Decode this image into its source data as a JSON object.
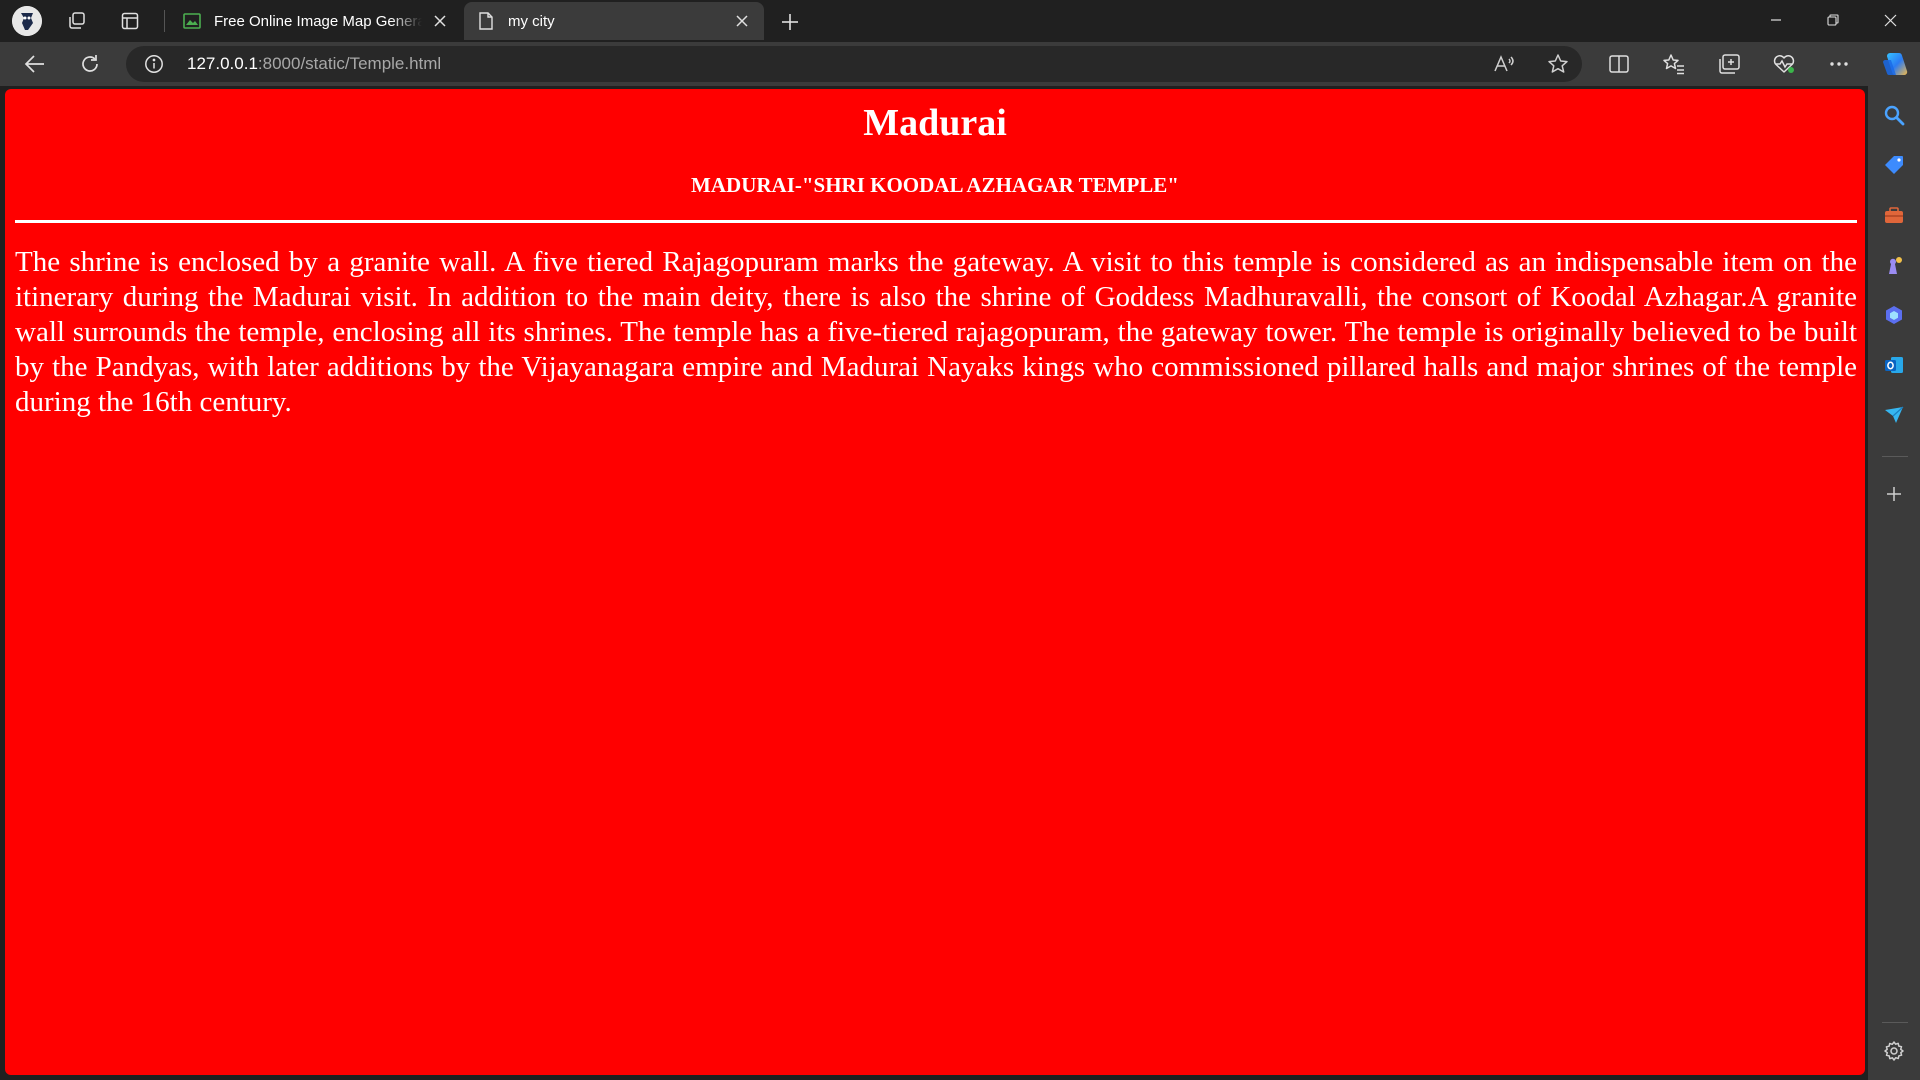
{
  "tabs": [
    {
      "title": "Free Online Image Map Generator",
      "active": false
    },
    {
      "title": "my city",
      "active": true
    }
  ],
  "address": {
    "host": "127.0.0.1",
    "rest": ":8000/static/Temple.html"
  },
  "page": {
    "title": "Madurai",
    "subtitle": "MADURAI-\"SHRI KOODAL AZHAGAR TEMPLE\"",
    "body": "The shrine is enclosed by a granite wall. A five tiered Rajagopuram marks the gateway. A visit to this temple is considered as an indispensable item on the itinerary during the Madurai visit. In addition to the main deity, there is also the shrine of Goddess Madhuravalli, the consort of Koodal Azhagar.A granite wall surrounds the temple, enclosing all its shrines. The temple has a five-tiered rajagopuram, the gateway tower. The temple is originally believed to be built by the Pandyas, with later additions by the Vijayanagara empire and Madurai Nayaks kings who commissioned pillared halls and major shrines of the temple during the 16th century.",
    "background": "#ff0000"
  },
  "icons": {
    "titlebar": [
      "profile-avatar",
      "workspaces-icon",
      "tab-actions-icon"
    ],
    "toolbar": [
      "back-icon",
      "refresh-icon",
      "site-info-icon",
      "read-aloud-icon",
      "favorite-star-icon",
      "split-screen-icon",
      "favorites-icon",
      "collections-icon",
      "browser-essentials-icon",
      "more-icon",
      "copilot-icon"
    ],
    "sidebar": [
      "search-icon",
      "shopping-icon",
      "tools-icon",
      "games-icon",
      "office-icon",
      "outlook-icon",
      "drop-icon",
      "add-icon",
      "settings-icon"
    ]
  }
}
